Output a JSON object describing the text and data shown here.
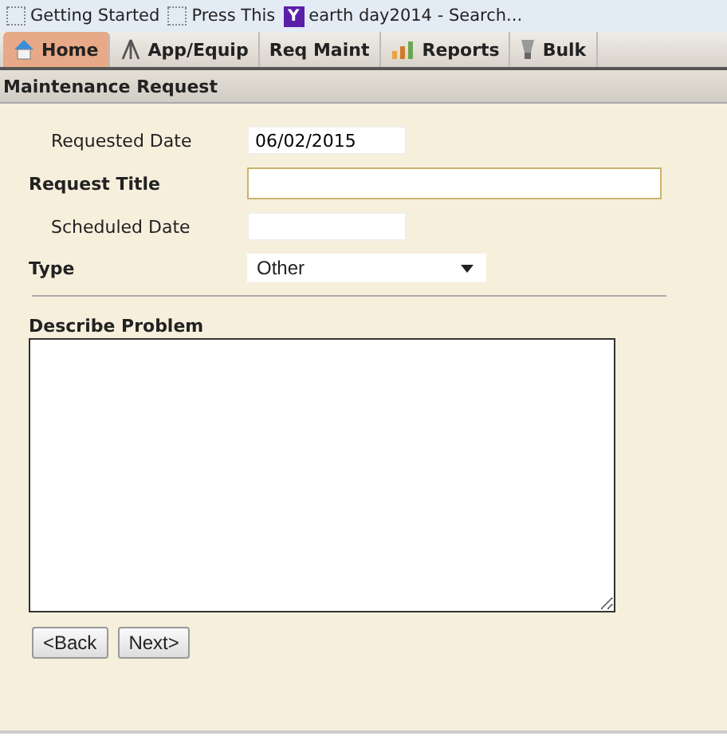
{
  "bookmarks": [
    {
      "label": "Getting Started"
    },
    {
      "label": "Press This"
    },
    {
      "label": "earth day2014 - Search..."
    }
  ],
  "bookmark_y_letter": "Y",
  "tabs": [
    {
      "label": "Home",
      "selected": true
    },
    {
      "label": "App/Equip",
      "selected": false
    },
    {
      "label": "Req Maint",
      "selected": false
    },
    {
      "label": "Reports",
      "selected": false
    },
    {
      "label": "Bulk",
      "selected": false
    }
  ],
  "section_title": "Maintenance Request",
  "fields": [
    {
      "label": "Requested Date",
      "bold": false,
      "kind": "short",
      "value": "06/02/2015"
    },
    {
      "label": "Request Title",
      "bold": true,
      "kind": "wide"
    },
    {
      "label": "Scheduled Date",
      "bold": false,
      "kind": "short"
    },
    {
      "label": "Type",
      "bold": true,
      "kind": "select",
      "value": "Other"
    }
  ],
  "problem_label": "Describe Problem",
  "buttons": [
    "<Back",
    "Next>"
  ]
}
